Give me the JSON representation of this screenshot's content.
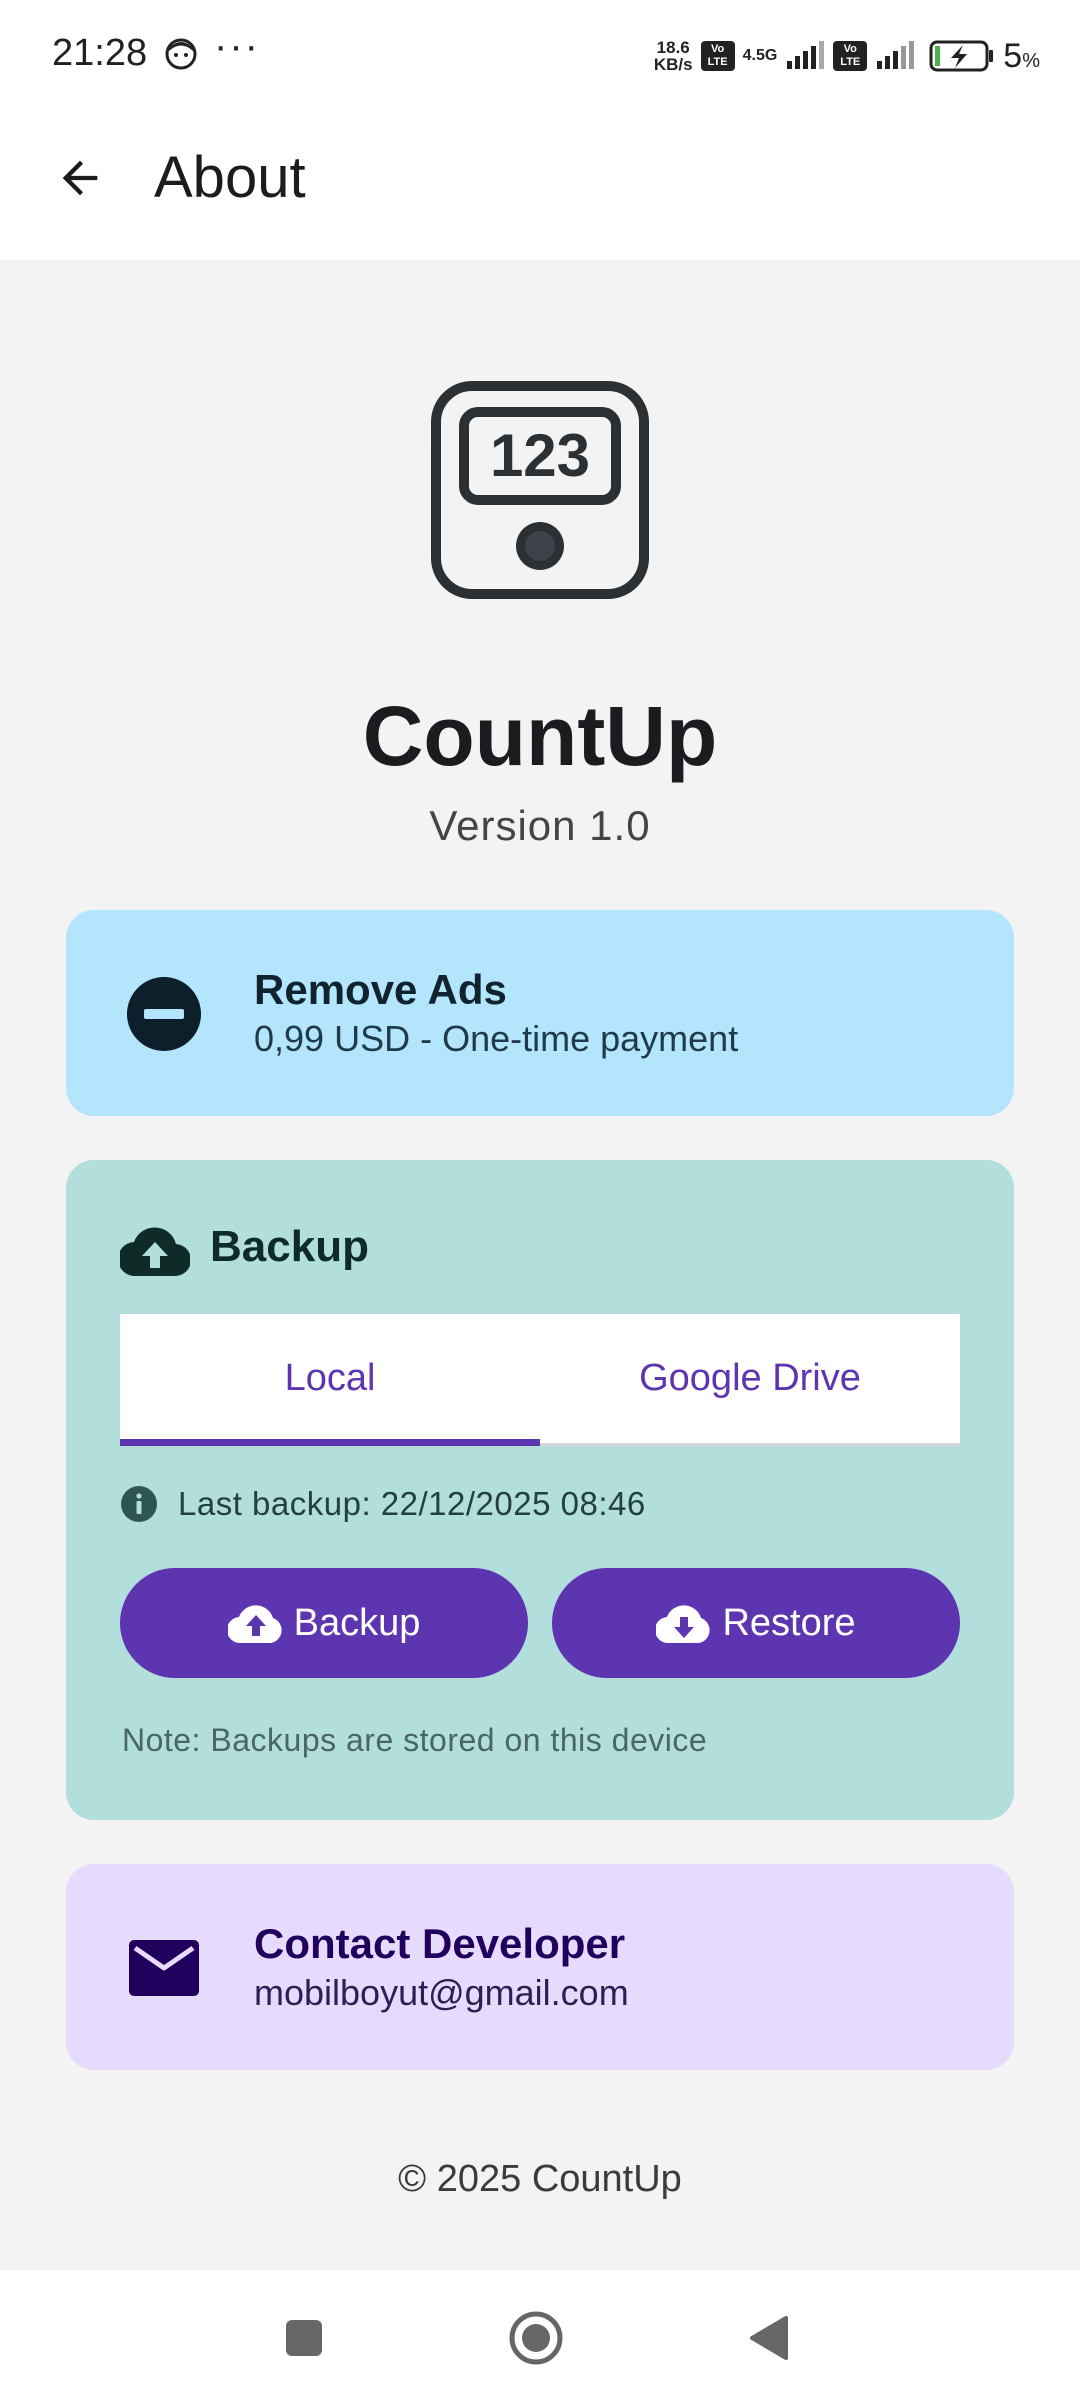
{
  "status_bar": {
    "time": "21:28",
    "more": "···",
    "speed_value": "18.6",
    "speed_unit": "KB/s",
    "volte_1": "Vo LTE",
    "network_1": "4.5G",
    "volte_2": "Vo LTE",
    "battery_percent": "5",
    "battery_percent_sign": "%"
  },
  "app_bar": {
    "title": "About"
  },
  "app": {
    "name": "CountUp",
    "version": "Version 1.0",
    "logo_digits": "123"
  },
  "remove_ads": {
    "title": "Remove Ads",
    "subtitle": "0,99 USD - One-time payment",
    "icon": "minus-circle-icon"
  },
  "backup": {
    "header": "Backup",
    "tabs": [
      {
        "label": "Local",
        "active": true
      },
      {
        "label": "Google Drive",
        "active": false
      }
    ],
    "last_backup": "Last backup: 22/12/2025 08:46",
    "backup_button": "Backup",
    "restore_button": "Restore",
    "note": "Note: Backups are stored on this device"
  },
  "contact": {
    "title": "Contact Developer",
    "email": "mobilboyut@gmail.com",
    "icon": "mail-icon"
  },
  "footer": {
    "copyright": "© 2025 CountUp"
  },
  "colors": {
    "accent": "#5e35b1",
    "ads_card": "#b3e5fc",
    "backup_card": "#b2dfdb",
    "contact_card": "#e6dbfd"
  }
}
